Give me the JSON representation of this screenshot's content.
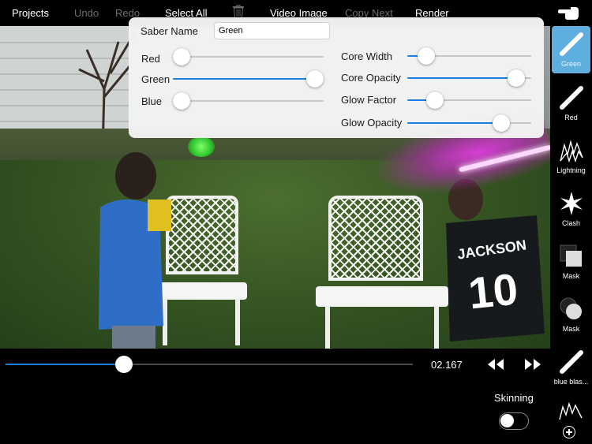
{
  "toolbar": {
    "projects": "Projects",
    "undo": "Undo",
    "redo": "Redo",
    "select_all": "Select All",
    "trash_icon": "trash-icon",
    "video_image": "Video Image",
    "copy_next": "Copy Next",
    "render": "Render"
  },
  "panel": {
    "saber_name_label": "Saber Name",
    "saber_name_value": "Green",
    "sliders_left": [
      {
        "label": "Red",
        "value": 0.0
      },
      {
        "label": "Green",
        "value": 1.0
      },
      {
        "label": "Blue",
        "value": 0.0
      }
    ],
    "sliders_right": [
      {
        "label": "Core Width",
        "value": 0.15
      },
      {
        "label": "Core Opacity",
        "value": 0.88
      },
      {
        "label": "Glow Factor",
        "value": 0.22
      },
      {
        "label": "Glow Opacity",
        "value": 0.76
      }
    ]
  },
  "sidebar": {
    "top_icon": "hand-pointer-icon",
    "items": [
      {
        "label": "Green",
        "icon": "saber-icon",
        "selected": true
      },
      {
        "label": "Red",
        "icon": "saber-icon",
        "selected": false
      },
      {
        "label": "Lightning",
        "icon": "lightning-icon",
        "selected": false
      },
      {
        "label": "Clash",
        "icon": "clash-star-icon",
        "selected": false
      },
      {
        "label": "Mask",
        "icon": "mask-square-icon",
        "selected": false
      },
      {
        "label": "Mask",
        "icon": "mask-circle-icon",
        "selected": false
      },
      {
        "label": "blue blas...",
        "icon": "saber-icon",
        "selected": false
      }
    ]
  },
  "timeline": {
    "time": "02.167",
    "progress": 0.29,
    "skinning_label": "Skinning",
    "skinning_on": false
  },
  "colors": {
    "accent": "#1a7fe0",
    "selected_tool": "#5faee0"
  }
}
